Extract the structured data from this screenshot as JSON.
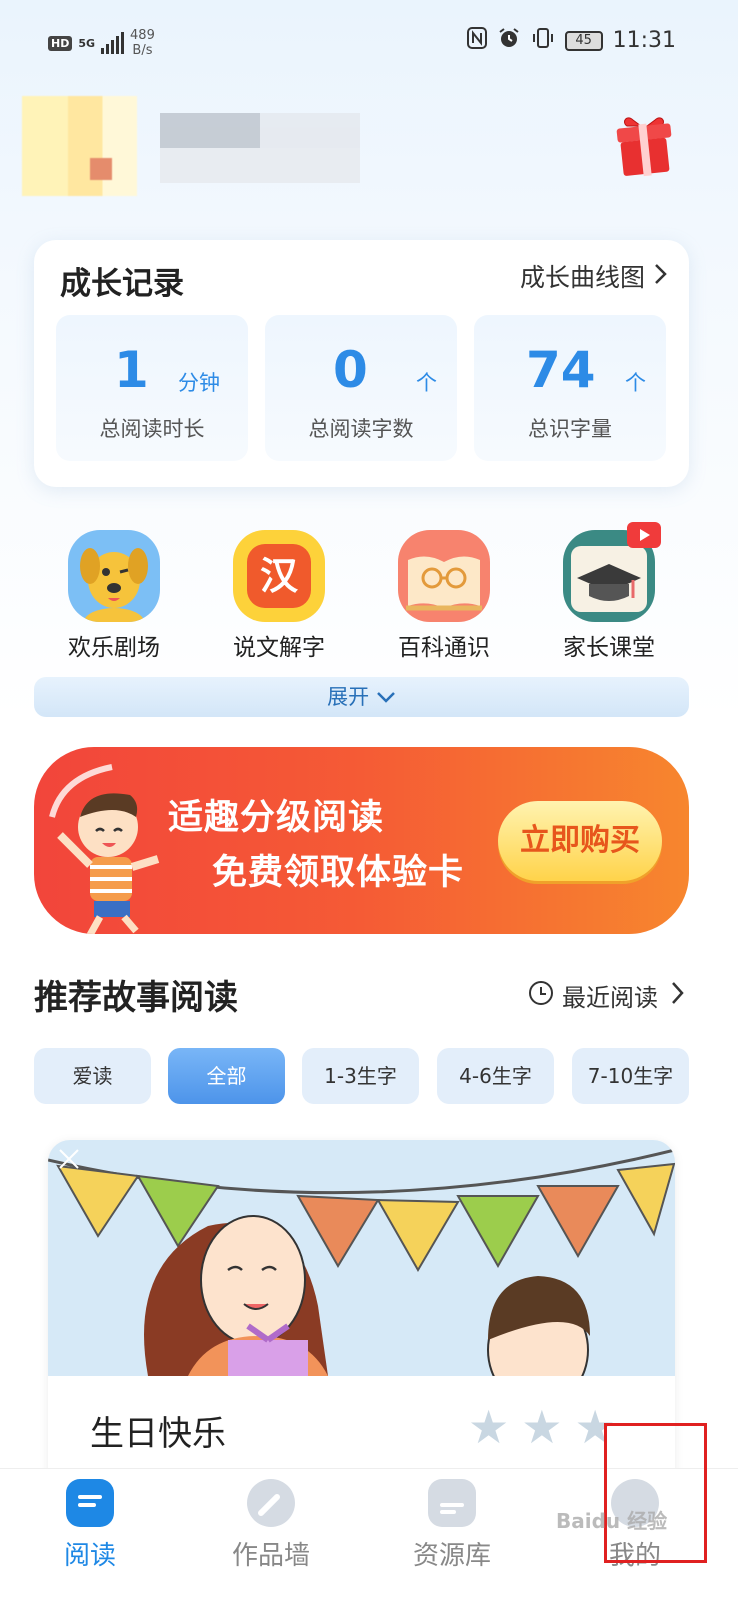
{
  "status_bar": {
    "hd": "HD",
    "network_type": "5G",
    "speed_value": "489",
    "speed_unit": "B/s",
    "battery": "45",
    "time": "11:31"
  },
  "growth": {
    "title": "成长记录",
    "curve_link": "成长曲线图",
    "stats": [
      {
        "value": "1",
        "unit": "分钟",
        "label": "总阅读时长"
      },
      {
        "value": "0",
        "unit": "个",
        "label": "总阅读字数"
      },
      {
        "value": "74",
        "unit": "个",
        "label": "总识字量"
      }
    ]
  },
  "features": [
    {
      "label": "欢乐剧场",
      "icon": "dog-icon"
    },
    {
      "label": "说文解字",
      "icon": "han-character-icon",
      "glyph": "汉"
    },
    {
      "label": "百科通识",
      "icon": "book-glasses-icon"
    },
    {
      "label": "家长课堂",
      "icon": "graduation-cap-icon"
    }
  ],
  "expand_label": "展开",
  "banner": {
    "line1": "适趣分级阅读",
    "line2": "免费领取体验卡",
    "button": "立即购买"
  },
  "recommend": {
    "title": "推荐故事阅读",
    "recent_link": "最近阅读",
    "tabs": [
      {
        "label": "爱读",
        "active": false
      },
      {
        "label": "全部",
        "active": true
      },
      {
        "label": "1-3生字",
        "active": false
      },
      {
        "label": "4-6生字",
        "active": false
      },
      {
        "label": "7-10生字",
        "active": false
      }
    ]
  },
  "story": {
    "title": "生日快乐",
    "rating": 0,
    "max_rating": 3
  },
  "bottom_nav": [
    {
      "label": "阅读",
      "active": true
    },
    {
      "label": "作品墙",
      "active": false
    },
    {
      "label": "资源库",
      "active": false
    },
    {
      "label": "我的",
      "active": false
    }
  ],
  "watermark": "Baidu 经验",
  "colors": {
    "primary": "#1e88e5",
    "stat_blue": "#2d8be6",
    "banner_red": "#f2453b",
    "highlight_red": "#e02020"
  }
}
